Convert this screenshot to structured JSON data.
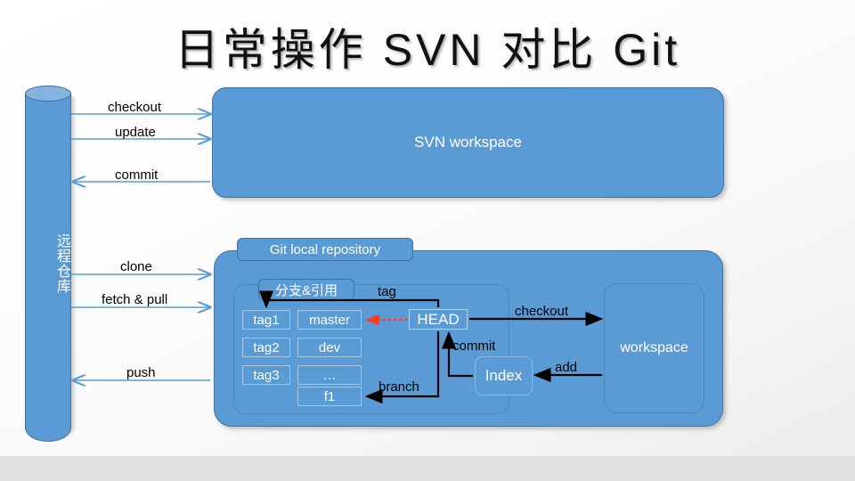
{
  "slide": {
    "title": "日常操作 SVN 对比 Git"
  },
  "remote_repo": {
    "name": "remote-repository-cylinder",
    "label": "远程仓库"
  },
  "svn": {
    "workspace_label": "SVN workspace",
    "arrows": [
      {
        "label": "checkout",
        "direction": "right"
      },
      {
        "label": "update",
        "direction": "right"
      },
      {
        "label": "commit",
        "direction": "left"
      }
    ]
  },
  "git": {
    "container_label": "Git local repository",
    "refs_group_label": "分支&引用",
    "tags": [
      "tag1",
      "tag2",
      "tag3"
    ],
    "branches": [
      "master",
      "dev",
      "…",
      "f1"
    ],
    "head_label": "HEAD",
    "index_label": "Index",
    "workspace_label": "workspace",
    "remote_arrows": [
      {
        "label": "clone",
        "direction": "right"
      },
      {
        "label": "fetch & pull",
        "direction": "right"
      },
      {
        "label": "push",
        "direction": "left"
      }
    ],
    "internal_arrows": [
      {
        "label": "tag",
        "from": "HEAD",
        "to": "tag1",
        "color": "#000000"
      },
      {
        "label": "",
        "from": "HEAD",
        "to": "master",
        "color": "#ff3b1e",
        "style": "dotted"
      },
      {
        "label": "branch",
        "from": "HEAD",
        "to": "f1",
        "color": "#000000"
      },
      {
        "label": "commit",
        "from": "Index",
        "to": "HEAD",
        "color": "#000000"
      },
      {
        "label": "checkout",
        "from": "HEAD",
        "to": "workspace",
        "color": "#000000"
      },
      {
        "label": "add",
        "from": "workspace",
        "to": "Index",
        "color": "#000000"
      }
    ]
  },
  "colors": {
    "shape_fill": "#5b9bd5",
    "shape_border": "#41719c",
    "arrow_blue": "#5b9bd5",
    "arrow_black": "#000000",
    "arrow_red": "#ff3b1e",
    "background": "#fdfdfd",
    "footer_band": "#e0e0e0"
  }
}
